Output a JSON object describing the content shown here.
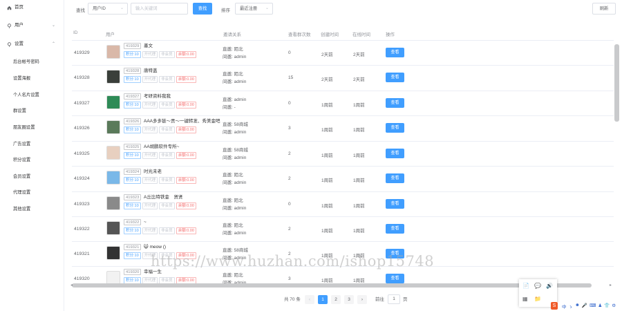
{
  "sidebar": {
    "items": [
      {
        "label": "首页",
        "icon": "home-icon"
      },
      {
        "label": "用户",
        "icon": "location-icon"
      },
      {
        "label": "设置",
        "icon": "location-icon"
      }
    ],
    "sub_items": [
      "后台帐号密码",
      "设置海报",
      "个人名片设置",
      "群设置",
      "朋友圈设置",
      "广告设置",
      "积分设置",
      "会员设置",
      "代理设置",
      "其他设置"
    ]
  },
  "toolbar": {
    "search_label": "查找",
    "search_field": "用户ID",
    "keyword_placeholder": "输入关键词",
    "search_button": "查找",
    "sort_label": "排序",
    "sort_value": "最近注册",
    "refresh_button": "刷新"
  },
  "table": {
    "headers": [
      "ID",
      "用户",
      "邀请关系",
      "查看群次数",
      "创建时间",
      "在线时间",
      "操作"
    ],
    "direct_prefix": "直邀:",
    "indirect_prefix": "间邀:",
    "tag_points": "积分:10",
    "tag_upgrade": "开代理",
    "tag_member": "非会员",
    "tag_balance": "余额:0.00",
    "view_button": "查看",
    "rows": [
      {
        "id": "419329",
        "uid": "419329",
        "name": "墨文",
        "direct": "陌北",
        "indirect": "admin",
        "views": "0",
        "created": "2天前",
        "online": "2天前",
        "avatar_color": "#d9b8a8"
      },
      {
        "id": "419328",
        "uid": "419328",
        "name": "唐特盖",
        "direct": "陌北",
        "indirect": "admin",
        "views": "15",
        "created": "2天前",
        "online": "2天前",
        "avatar_color": "#3a3f3a"
      },
      {
        "id": "419327",
        "uid": "419327",
        "name": "考研资料我我",
        "direct": "admin",
        "indirect": "-",
        "views": "0",
        "created": "1周前",
        "online": "1周前",
        "avatar_color": "#2e8b57"
      },
      {
        "id": "419326",
        "uid": "419326",
        "name": "AAA多多链～贡～一键转发、秀美金吧",
        "direct": "58商城",
        "indirect": "admin",
        "views": "3",
        "created": "1周前",
        "online": "1周前",
        "avatar_color": "#5a7a5a"
      },
      {
        "id": "419325",
        "uid": "419325",
        "name": "AA胡鹏软件专所~",
        "direct": "58商城",
        "indirect": "admin",
        "views": "2",
        "created": "1周前",
        "online": "1周前",
        "avatar_color": "#e8d0c0"
      },
      {
        "id": "419324",
        "uid": "419324",
        "name": "时光未老",
        "direct": "陌北",
        "indirect": "admin",
        "views": "2",
        "created": "1周前",
        "online": "1周前",
        "avatar_color": "#7ab8e8"
      },
      {
        "id": "419323",
        "uid": "419323",
        "name": "A丘比特铁金　贤贤",
        "direct": "陌北",
        "indirect": "admin",
        "views": "0",
        "created": "1周前",
        "online": "1周前",
        "avatar_color": "#8a8a8a"
      },
      {
        "id": "419322",
        "uid": "419322",
        "name": "~",
        "direct": "陌北",
        "indirect": "admin",
        "views": "2",
        "created": "1周前",
        "online": "1周前",
        "avatar_color": "#555555"
      },
      {
        "id": "419321",
        "uid": "419321",
        "name": "😺 meow ()",
        "direct": "58商城",
        "indirect": "admin",
        "views": "2",
        "created": "1周前",
        "online": "1周前",
        "avatar_color": "#333333"
      },
      {
        "id": "419320",
        "uid": "419320",
        "name": "幸福一生",
        "direct": "陌北",
        "indirect": "admin",
        "views": "3",
        "created": "1周前",
        "online": "1周前",
        "avatar_color": "#f2f2f2"
      }
    ]
  },
  "pagination": {
    "total": "共 70 条",
    "pages": [
      "1",
      "2",
      "3"
    ],
    "goto_label": "前往",
    "goto_value": "1",
    "page_suffix": "页",
    "prev": "‹",
    "next": "›"
  },
  "watermark": "https://www.huzhan.com/ishop15748",
  "colors": {
    "primary": "#409eff",
    "danger": "#f56c6c",
    "border": "#ebeef5"
  },
  "scroll_arrows": {
    "left": "◂",
    "right": "▸"
  },
  "taskbar": {
    "items": [
      "中",
      "ゝ",
      "☻",
      "🎤",
      "⌨",
      "♟",
      "👕",
      "⚙"
    ]
  },
  "tray": {
    "icons": [
      "📄",
      "💬",
      "🔊",
      "▦",
      "📁"
    ]
  }
}
